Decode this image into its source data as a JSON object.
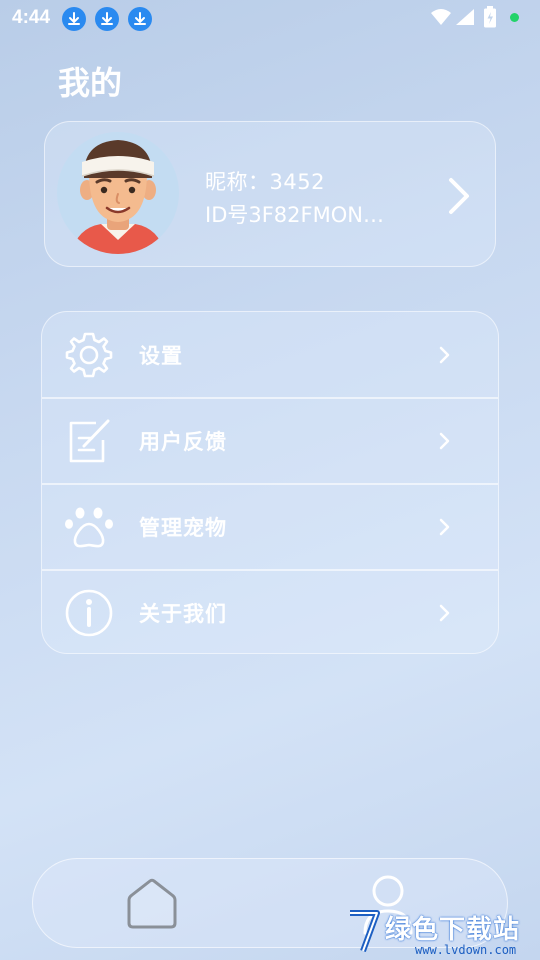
{
  "status_bar": {
    "time": "4:44",
    "download_icons": [
      "download-icon",
      "download-icon",
      "download-icon"
    ],
    "right_icons": [
      "wifi-icon",
      "signal-icon",
      "battery-icon",
      "notification-dot-icon"
    ],
    "dot_color": "#22d36a"
  },
  "page": {
    "title": "我的"
  },
  "profile": {
    "nickname": "昵称：3452",
    "user_id": "ID号3F82FMON…",
    "avatar_icon": "avatar-headband-boy"
  },
  "menu": {
    "items": [
      {
        "label": "设置",
        "icon": "gear-icon"
      },
      {
        "label": "用户反馈",
        "icon": "feedback-edit-icon"
      },
      {
        "label": "管理宠物",
        "icon": "paw-icon"
      },
      {
        "label": "关于我们",
        "icon": "info-icon"
      }
    ]
  },
  "tab_bar": {
    "tabs": [
      {
        "name": "home",
        "icon": "home-icon"
      },
      {
        "name": "profile",
        "icon": "person-icon"
      }
    ]
  },
  "watermark": {
    "text": "绿色下载站",
    "url": "www.lvdown.com"
  },
  "colors": {
    "background": "#c7d8f0",
    "download_badge": "#2a8af0",
    "watermark": "#1d5fc2"
  }
}
